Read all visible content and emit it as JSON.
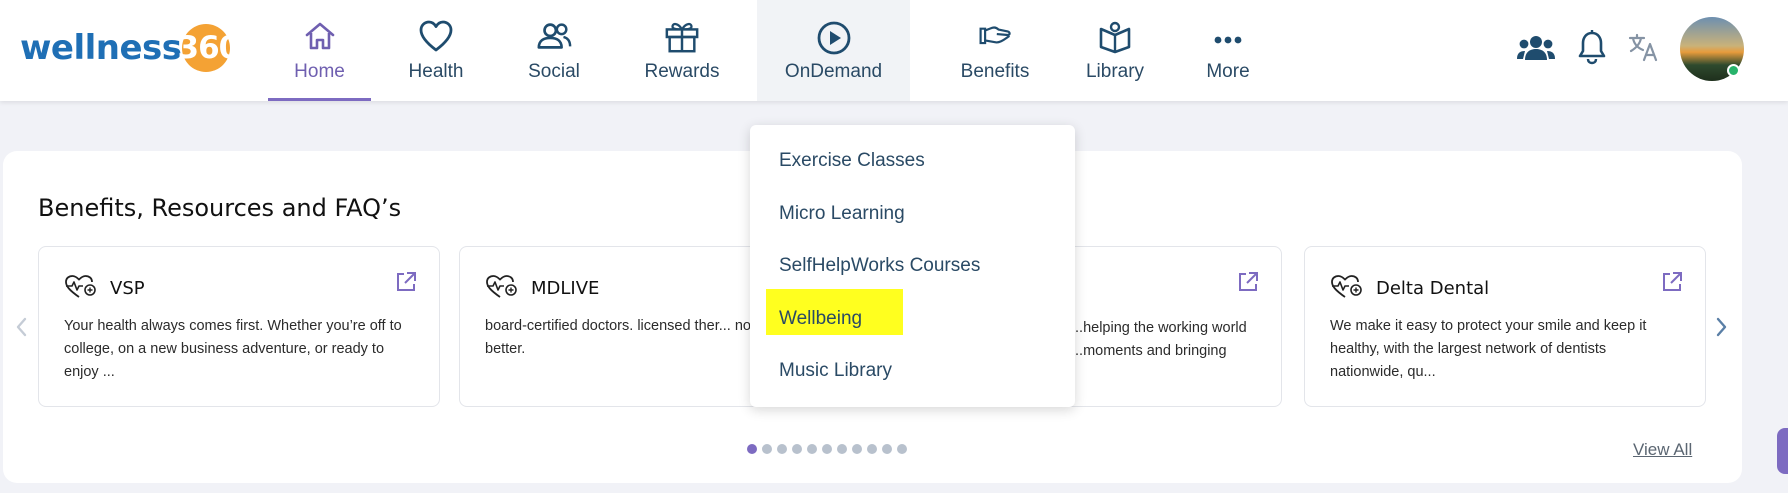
{
  "brand": {
    "logo_text": "wellness",
    "logo_number": "360",
    "colors": {
      "blue": "#1f6fb5",
      "orange": "#f4a234",
      "accent": "#7d6bc1"
    }
  },
  "nav": {
    "items": [
      {
        "label": "Home",
        "icon": "home-icon",
        "active": true
      },
      {
        "label": "Health",
        "icon": "heart-icon"
      },
      {
        "label": "Social",
        "icon": "people-icon"
      },
      {
        "label": "Rewards",
        "icon": "gift-icon"
      },
      {
        "label": "OnDemand",
        "icon": "play-circle-icon",
        "hovered": true
      },
      {
        "label": "Benefits",
        "icon": "hand-icon"
      },
      {
        "label": "Library",
        "icon": "book-icon"
      },
      {
        "label": "More",
        "icon": "more-dots-icon"
      }
    ]
  },
  "header_right": {
    "icons": [
      "group-icon",
      "bell-icon",
      "translate-icon",
      "avatar"
    ]
  },
  "dropdown": {
    "items": [
      {
        "label": "Exercise Classes"
      },
      {
        "label": "Micro Learning"
      },
      {
        "label": "SelfHelpWorks Courses"
      },
      {
        "label": "Wellbeing",
        "highlighted": true
      },
      {
        "label": "Music Library"
      }
    ]
  },
  "section": {
    "title": "Benefits, Resources and FAQ’s",
    "view_all": "View All",
    "cards": [
      {
        "title": "VSP",
        "desc": "Your health always comes first. Whether you’re off to college, on a new business adventure, or ready to enjoy ..."
      },
      {
        "title": "MDLIVE",
        "desc": "board-certified doctors. licensed ther... now. that’s better."
      },
      {
        "title": "",
        "desc": "...helping the working world ...moments and bringing"
      },
      {
        "title": "Delta Dental",
        "desc": "We make it easy to protect your smile and keep it healthy, with the largest network of dentists nationwide, qu..."
      }
    ],
    "carousel": {
      "page_count": 11,
      "current_page": 1
    }
  }
}
